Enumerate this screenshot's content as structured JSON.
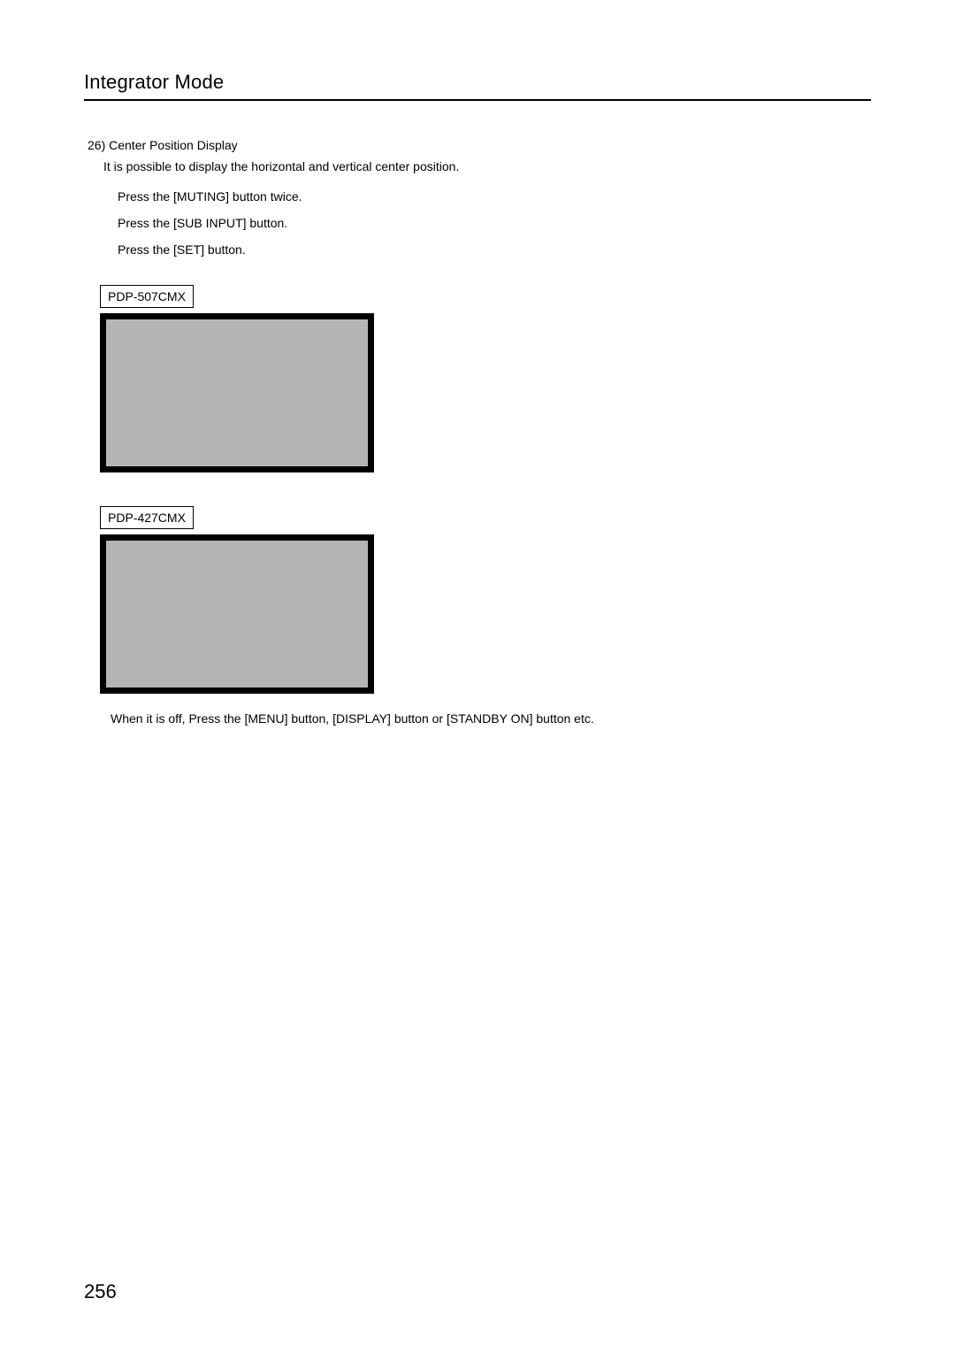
{
  "header": {
    "title": "Integrator Mode"
  },
  "section": {
    "number_title": "26) Center Position Display",
    "description": "It is possible to display the horizontal and vertical center position.",
    "steps": [
      "Press the [MUTING] button twice.",
      "Press the [SUB INPUT] button.",
      "Press the [SET] button."
    ],
    "models": {
      "model1": "PDP-507CMX",
      "model2": "PDP-427CMX"
    },
    "note": "When it is off, Press the [MENU] button, [DISPLAY] button or [STANDBY ON] button etc."
  },
  "footer": {
    "page_number": "256"
  }
}
